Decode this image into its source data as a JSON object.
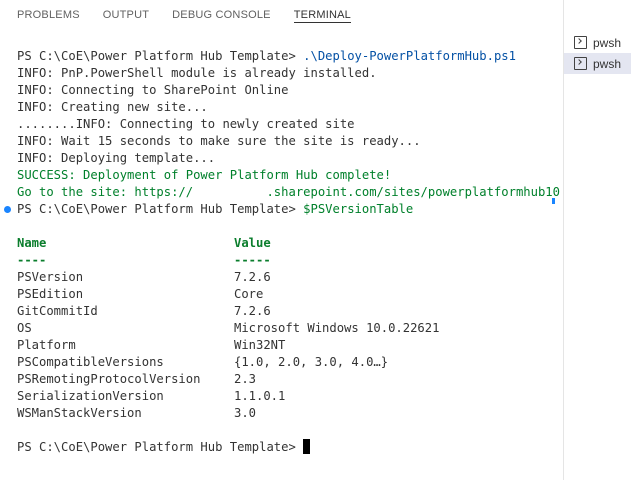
{
  "panel": {
    "tabs": [
      {
        "label": "PROBLEMS"
      },
      {
        "label": "OUTPUT"
      },
      {
        "label": "DEBUG CONSOLE"
      },
      {
        "label": "TERMINAL"
      }
    ]
  },
  "sidebar": {
    "terminals": [
      {
        "label": "pwsh"
      },
      {
        "label": "pwsh"
      }
    ]
  },
  "terminal": {
    "prompt": "PS C:\\CoE\\Power Platform Hub Template> ",
    "cmd1": ".\\Deploy-PowerPlatformHub.ps1",
    "out": [
      "INFO: PnP.PowerShell module is already installed.",
      "INFO: Connecting to SharePoint Online",
      "INFO: Creating new site...",
      "........INFO: Connecting to newly created site",
      "INFO: Wait 15 seconds to make sure the site is ready...",
      "INFO: Deploying template..."
    ],
    "success": "SUCCESS: Deployment of Power Platform Hub complete!",
    "goto": "Go to the site: https://          .sharepoint.com/sites/powerplatformhub10",
    "cmd2": "$PSVersionTable",
    "table": {
      "col_name": "Name",
      "col_value": "Value",
      "sep_name": "----",
      "sep_value": "-----",
      "rows": [
        {
          "name": "PSVersion",
          "value": "7.2.6"
        },
        {
          "name": "PSEdition",
          "value": "Core"
        },
        {
          "name": "GitCommitId",
          "value": "7.2.6"
        },
        {
          "name": "OS",
          "value": "Microsoft Windows 10.0.22621"
        },
        {
          "name": "Platform",
          "value": "Win32NT"
        },
        {
          "name": "PSCompatibleVersions",
          "value": "{1.0, 2.0, 3.0, 4.0…}"
        },
        {
          "name": "PSRemotingProtocolVersion",
          "value": "2.3"
        },
        {
          "name": "SerializationVersion",
          "value": "1.1.0.1"
        },
        {
          "name": "WSManStackVersion",
          "value": "3.0"
        }
      ]
    }
  }
}
